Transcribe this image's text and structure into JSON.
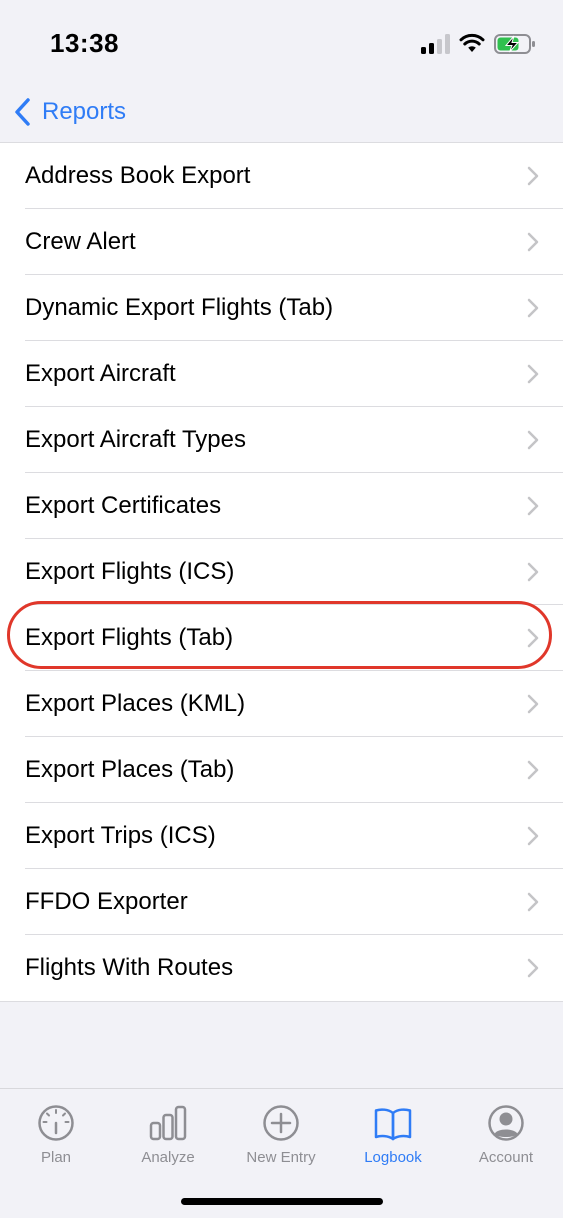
{
  "status_bar": {
    "time": "13:38",
    "signal_icon": "cellular-signal-icon",
    "wifi_icon": "wifi-icon",
    "battery_icon": "battery-charging-icon",
    "battery_level": 0.7
  },
  "nav": {
    "back_label": "Reports",
    "back_icon": "chevron-left-icon"
  },
  "list": {
    "items": [
      {
        "label": "Address Book Export"
      },
      {
        "label": "Crew Alert"
      },
      {
        "label": "Dynamic Export Flights (Tab)"
      },
      {
        "label": "Export Aircraft"
      },
      {
        "label": "Export Aircraft Types"
      },
      {
        "label": "Export Certificates"
      },
      {
        "label": "Export Flights (ICS)"
      },
      {
        "label": "Export Flights (Tab)",
        "highlighted": true
      },
      {
        "label": "Export Places (KML)"
      },
      {
        "label": "Export Places (Tab)"
      },
      {
        "label": "Export Trips (ICS)"
      },
      {
        "label": "FFDO Exporter"
      },
      {
        "label": "Flights With Routes"
      }
    ]
  },
  "tab_bar": {
    "tabs": [
      {
        "label": "Plan",
        "icon": "gauge-icon",
        "active": false
      },
      {
        "label": "Analyze",
        "icon": "bar-chart-icon",
        "active": false
      },
      {
        "label": "New Entry",
        "icon": "plus-circle-icon",
        "active": false
      },
      {
        "label": "Logbook",
        "icon": "book-icon",
        "active": true
      },
      {
        "label": "Account",
        "icon": "person-circle-icon",
        "active": false
      }
    ]
  },
  "colors": {
    "accent": "#2f7cf6",
    "highlight": "#e0372a",
    "inactive": "#8e8e93",
    "background": "#f2f2f7"
  }
}
